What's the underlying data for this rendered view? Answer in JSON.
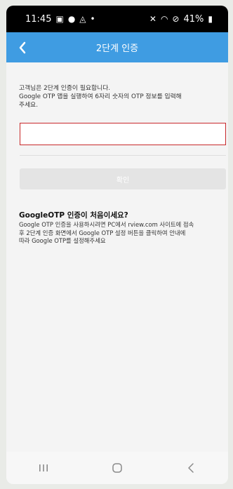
{
  "status_bar": {
    "time": "11:45",
    "left_icons": [
      "gallery-icon",
      "location-pin-icon",
      "landscape-icon",
      "dot"
    ],
    "right_text": "41%"
  },
  "header": {
    "title": "2단계 인증"
  },
  "intro": {
    "line1": "고객님은 2단계 인증이 필요합니다.",
    "line2": "Google OTP 앱을 실행하여 6자리 숫자의 OTP 정보를 입력해",
    "line3": "주세요."
  },
  "otp": {
    "value": "",
    "placeholder": ""
  },
  "confirm": {
    "label": "확인"
  },
  "help": {
    "title": "GoogleOTP 인증이 처음이세요?",
    "line1": "Google OTP 인증을 사용하시려면 PC에서 rview.com 사이트에 접속",
    "line2": "후 2단계 인증 화면에서 Google OTP 설정 버튼을 클릭하여 안내에",
    "line3": "따라 Google OTP를 설정해주세요"
  },
  "colors": {
    "header": "#3f9ce2",
    "input_border": "#c8292b",
    "button_disabled": "#e4e4e4"
  }
}
